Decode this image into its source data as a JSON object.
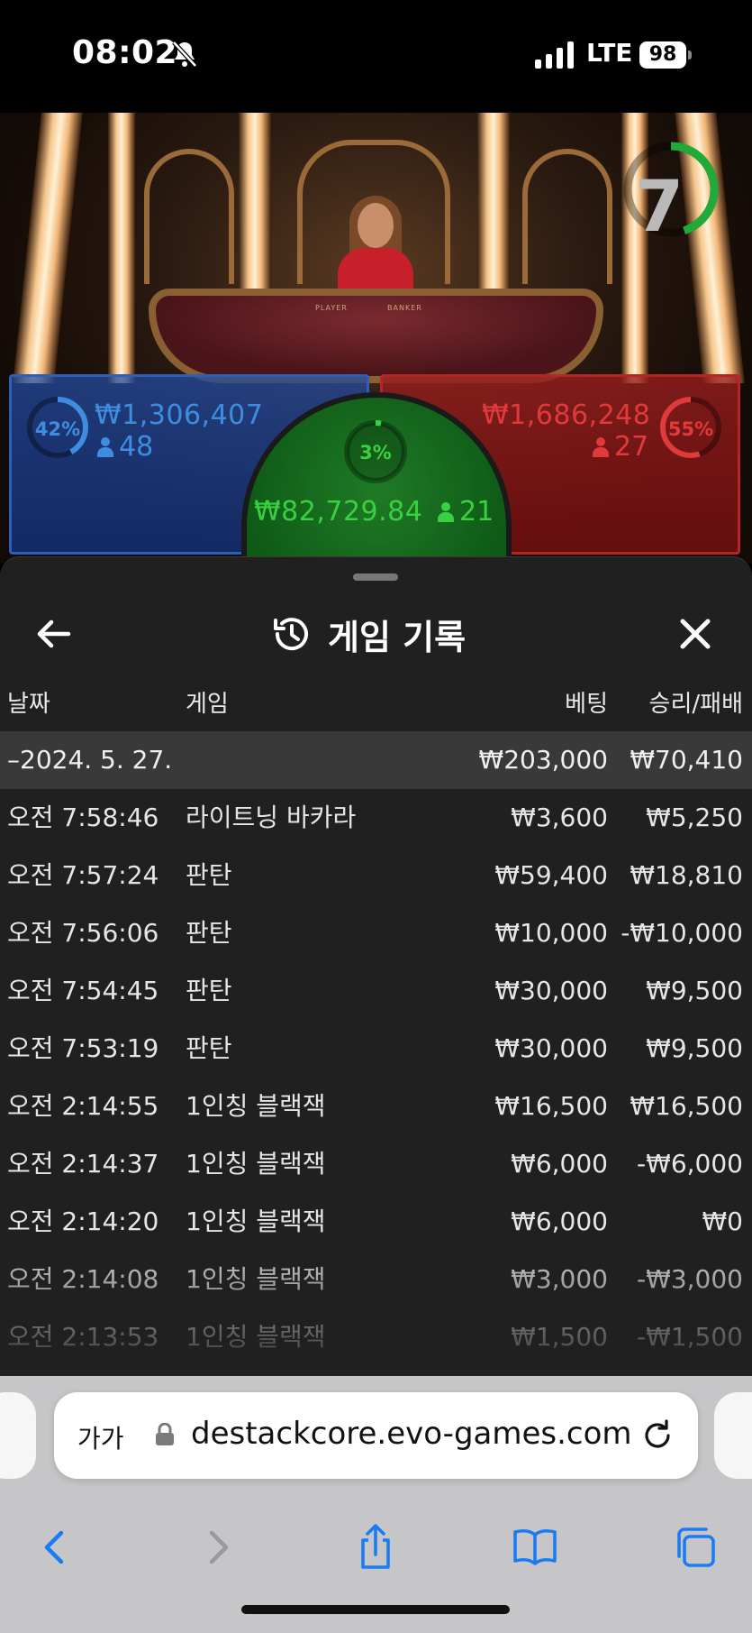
{
  "status_bar": {
    "time": "08:02",
    "network": "LTE",
    "battery": "98",
    "icons": [
      "bell-slash-icon",
      "signal-icon"
    ]
  },
  "game": {
    "countdown": "7",
    "countdown_progress": 0.45,
    "table_labels": {
      "player": "PLAYER",
      "banker": "BANKER"
    },
    "player": {
      "percent": "42%",
      "amount": "₩1,306,407",
      "players": "48",
      "ring_fraction": 0.42
    },
    "banker": {
      "percent": "55%",
      "amount": "₩1,686,248",
      "players": "27",
      "ring_fraction": 0.55
    },
    "tie": {
      "percent": "3%",
      "amount": "₩82,729.84",
      "players": "21",
      "ring_fraction": 0.03
    },
    "colors": {
      "player": "#3f8de0",
      "banker": "#e03a3a",
      "tie": "#39d142"
    }
  },
  "history": {
    "title": "게임 기록",
    "icons": {
      "back": "arrow-left-icon",
      "history": "history-clock-icon",
      "close": "close-icon"
    },
    "columns": {
      "date": "날짜",
      "game": "게임",
      "bet": "베팅",
      "result": "승리/패배"
    },
    "date_group": {
      "label": "–2024. 5. 27.",
      "bet_total": "₩203,000",
      "result_total": "₩70,410"
    },
    "rows": [
      {
        "time": "오전 7:58:46",
        "game": "라이트닝 바카라",
        "bet": "₩3,600",
        "result": "₩5,250"
      },
      {
        "time": "오전 7:57:24",
        "game": "판탄",
        "bet": "₩59,400",
        "result": "₩18,810"
      },
      {
        "time": "오전 7:56:06",
        "game": "판탄",
        "bet": "₩10,000",
        "result": "-₩10,000"
      },
      {
        "time": "오전 7:54:45",
        "game": "판탄",
        "bet": "₩30,000",
        "result": "₩9,500"
      },
      {
        "time": "오전 7:53:19",
        "game": "판탄",
        "bet": "₩30,000",
        "result": "₩9,500"
      },
      {
        "time": "오전 2:14:55",
        "game": "1인칭 블랙잭",
        "bet": "₩16,500",
        "result": "₩16,500"
      },
      {
        "time": "오전 2:14:37",
        "game": "1인칭 블랙잭",
        "bet": "₩6,000",
        "result": "-₩6,000"
      },
      {
        "time": "오전 2:14:20",
        "game": "1인칭 블랙잭",
        "bet": "₩6,000",
        "result": "₩0"
      },
      {
        "time": "오전 2:14:08",
        "game": "1인칭 블랙잭",
        "bet": "₩3,000",
        "result": "-₩3,000"
      },
      {
        "time": "오전 2:13:53",
        "game": "1인칭 블랙잭",
        "bet": "₩1,500",
        "result": "-₩1,500"
      }
    ]
  },
  "browser": {
    "text_size_label": "가가",
    "url": "destackcore.evo-games.com",
    "icons": [
      "lock-icon",
      "reload-icon",
      "back-icon",
      "forward-icon",
      "share-icon",
      "bookmarks-icon",
      "tabs-icon"
    ]
  }
}
